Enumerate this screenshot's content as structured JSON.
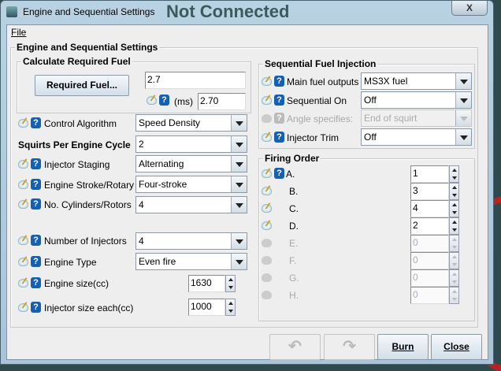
{
  "window": {
    "title": "Engine and Sequential Settings",
    "background_text": "Not Connected",
    "close": "X"
  },
  "menu": {
    "file": "File"
  },
  "main_group": "Engine and Sequential Settings",
  "req_fuel": {
    "title": "Calculate Required Fuel",
    "button": "Required Fuel...",
    "value": "2.7",
    "unit": "(ms)",
    "ms_value": "2.70"
  },
  "left": {
    "control_algorithm": {
      "label": "Control Algorithm",
      "value": "Speed Density"
    },
    "squirts": {
      "label": "Squirts Per Engine Cycle",
      "value": "2"
    },
    "injector_staging": {
      "label": "Injector Staging",
      "value": "Alternating"
    },
    "engine_stroke": {
      "label": "Engine Stroke/Rotary",
      "value": "Four-stroke"
    },
    "cylinders": {
      "label": "No. Cylinders/Rotors",
      "value": "4"
    },
    "num_injectors": {
      "label": "Number of Injectors",
      "value": "4"
    },
    "engine_type": {
      "label": "Engine Type",
      "value": "Even fire"
    },
    "engine_size": {
      "label": "Engine size(cc)",
      "value": "1630"
    },
    "injector_size": {
      "label": "Injector size each(cc)",
      "value": "1000"
    }
  },
  "seq": {
    "title": "Sequential Fuel Injection",
    "main_outputs": {
      "label": "Main fuel outputs",
      "value": "MS3X fuel"
    },
    "sequential_on": {
      "label": "Sequential On",
      "value": "Off"
    },
    "angle": {
      "label": "Angle specifies:",
      "value": "End of squirt"
    },
    "trim": {
      "label": "Injector Trim",
      "value": "Off"
    }
  },
  "firing": {
    "title": "Firing Order",
    "rows": [
      {
        "label": "A.",
        "value": "1"
      },
      {
        "label": "B.",
        "value": "3"
      },
      {
        "label": "C.",
        "value": "4"
      },
      {
        "label": "D.",
        "value": "2"
      },
      {
        "label": "E.",
        "value": "0"
      },
      {
        "label": "F.",
        "value": "0"
      },
      {
        "label": "G.",
        "value": "0"
      },
      {
        "label": "H.",
        "value": "0"
      }
    ]
  },
  "buttons": {
    "undo": "↶",
    "redo": "↷",
    "burn": "Burn",
    "close": "Close"
  }
}
